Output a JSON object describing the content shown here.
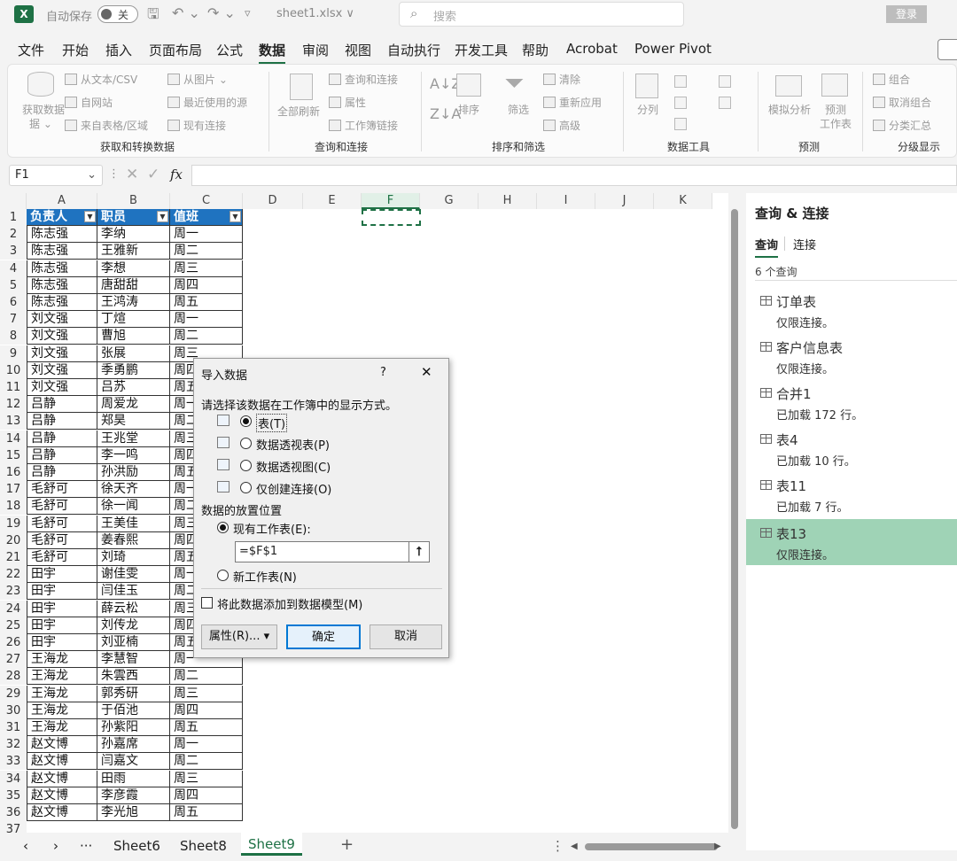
{
  "titlebar": {
    "app_icon": "X",
    "autosave_label": "自动保存",
    "autosave_state": "关",
    "filename": "sheet1.xlsx ∨",
    "search_placeholder": "搜索",
    "login": "登录"
  },
  "menu": [
    "文件",
    "开始",
    "插入",
    "页面布局",
    "公式",
    "数据",
    "审阅",
    "视图",
    "自动执行",
    "开发工具",
    "帮助",
    "Acrobat",
    "Power Pivot"
  ],
  "ribbon": {
    "get_data": "获取数据",
    "get_data2": "据 ⌄",
    "from_text": "从文本/CSV",
    "from_web": "自网站",
    "from_table": "来自表格/区域",
    "from_picture": "从图片 ⌄",
    "recent_sources": "最近使用的源",
    "existing_conn": "现有连接",
    "group1": "获取和转换数据",
    "refresh_all": "全部刷新",
    "queries_conn": "查询和连接",
    "properties": "属性",
    "workbook_links": "工作簿链接",
    "group2": "查询和连接",
    "sort": "排序",
    "filter": "筛选",
    "clear": "清除",
    "reapply": "重新应用",
    "advanced": "高级",
    "group3": "排序和筛选",
    "text_to_columns": "分列",
    "group4": "数据工具",
    "what_if": "模拟分析",
    "forecast_sheet": "预测",
    "forecast_sheet2": "工作表",
    "group5": "预测",
    "group_btn": "组合",
    "ungroup": "取消组合",
    "subtotal": "分类汇总",
    "group6": "分级显示"
  },
  "formula_bar": {
    "name_box": "F1",
    "fx": "fx",
    "value": ""
  },
  "columns": [
    "A",
    "B",
    "C",
    "D",
    "E",
    "F",
    "G",
    "H",
    "I",
    "J",
    "K"
  ],
  "table_headers": [
    "负责人",
    "职员",
    "值班"
  ],
  "rows": [
    [
      "陈志强",
      "李纳",
      "周一"
    ],
    [
      "陈志强",
      "王雅新",
      "周二"
    ],
    [
      "陈志强",
      "李想",
      "周三"
    ],
    [
      "陈志强",
      "唐甜甜",
      "周四"
    ],
    [
      "陈志强",
      "王鸿涛",
      "周五"
    ],
    [
      "刘文强",
      "丁煊",
      "周一"
    ],
    [
      "刘文强",
      "曹旭",
      "周二"
    ],
    [
      "刘文强",
      "张展",
      "周三"
    ],
    [
      "刘文强",
      "季勇鹏",
      "周四"
    ],
    [
      "刘文强",
      "吕苏",
      "周五"
    ],
    [
      "吕静",
      "周爱龙",
      "周一"
    ],
    [
      "吕静",
      "郑昊",
      "周二"
    ],
    [
      "吕静",
      "王兆堂",
      "周三"
    ],
    [
      "吕静",
      "李一鸣",
      "周四"
    ],
    [
      "吕静",
      "孙洪励",
      "周五"
    ],
    [
      "毛舒可",
      "徐天齐",
      "周一"
    ],
    [
      "毛舒可",
      "徐一闻",
      "周二"
    ],
    [
      "毛舒可",
      "王美佳",
      "周三"
    ],
    [
      "毛舒可",
      "姜春熙",
      "周四"
    ],
    [
      "毛舒可",
      "刘琦",
      "周五"
    ],
    [
      "田宇",
      "谢佳雯",
      "周一"
    ],
    [
      "田宇",
      "闫佳玉",
      "周二"
    ],
    [
      "田宇",
      "薛云松",
      "周三"
    ],
    [
      "田宇",
      "刘传龙",
      "周四"
    ],
    [
      "田宇",
      "刘亚楠",
      "周五"
    ],
    [
      "王海龙",
      "李慧智",
      "周一"
    ],
    [
      "王海龙",
      "朱雲西",
      "周二"
    ],
    [
      "王海龙",
      "郭秀研",
      "周三"
    ],
    [
      "王海龙",
      "于佰池",
      "周四"
    ],
    [
      "王海龙",
      "孙紫阳",
      "周五"
    ],
    [
      "赵文博",
      "孙嘉席",
      "周一"
    ],
    [
      "赵文博",
      "闫嘉文",
      "周二"
    ],
    [
      "赵文博",
      "田雨",
      "周三"
    ],
    [
      "赵文博",
      "李彦霞",
      "周四"
    ],
    [
      "赵文博",
      "李光旭",
      "周五"
    ]
  ],
  "sheet_tabs": [
    "Sheet6",
    "Sheet8",
    "Sheet9"
  ],
  "active_sheet": "Sheet9",
  "pane": {
    "title": "查询 & 连接",
    "tab_queries": "查询",
    "tab_connections": "连接",
    "count": "6 个查询",
    "items": [
      {
        "name": "订单表",
        "status": "仅限连接。"
      },
      {
        "name": "客户信息表",
        "status": "仅限连接。"
      },
      {
        "name": "合并1",
        "status": "已加载 172 行。"
      },
      {
        "name": "表4",
        "status": "已加载 10 行。"
      },
      {
        "name": "表11",
        "status": "已加载 7 行。"
      },
      {
        "name": "表13",
        "status": "仅限连接。"
      }
    ]
  },
  "dialog": {
    "title": "导入数据",
    "help": "?",
    "close": "✕",
    "prompt": "请选择该数据在工作簿中的显示方式。",
    "opt_table": "表(T)",
    "opt_pivot_table": "数据透视表(P)",
    "opt_pivot_chart": "数据透视图(C)",
    "opt_conn_only": "仅创建连接(O)",
    "placement_label": "数据的放置位置",
    "existing_ws": "现有工作表(E):",
    "range_value": "=$F$1",
    "new_ws": "新工作表(N)",
    "add_model": "将此数据添加到数据模型(M)",
    "properties_btn": "属性(R)... ▾",
    "ok": "确定",
    "cancel": "取消"
  }
}
